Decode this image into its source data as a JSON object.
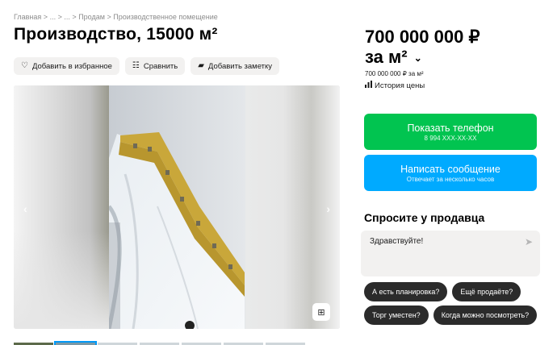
{
  "breadcrumb": {
    "items": [
      "Главная",
      "...",
      "...",
      "Продам",
      "Производственное помещение"
    ],
    "separator": ">"
  },
  "listing": {
    "title": "Производство, 15000 м²",
    "actions": [
      {
        "label": "Добавить в избранное",
        "icon": "heart-icon"
      },
      {
        "label": "Сравнить",
        "icon": "compare-icon"
      },
      {
        "label": "Добавить заметку",
        "icon": "note-icon"
      }
    ]
  },
  "gallery": {
    "prev_glyph": "‹",
    "next_glyph": "›",
    "expand_glyph": "⊞"
  },
  "price": {
    "main_line1": "700 000 000 ₽",
    "main_line2": "за м²",
    "chevron": "⌄",
    "sub": "700 000 000 ₽ за м²",
    "history_label": "История цены"
  },
  "contact": {
    "phone_button": {
      "label": "Показать телефон",
      "sub": "8 994 XXX-XX-XX"
    },
    "message_button": {
      "label": "Написать сообщение",
      "sub": "Отвечает за несколько часов"
    }
  },
  "ask_seller": {
    "heading": "Спросите у продавца",
    "message_value": "Здравствуйте!",
    "send_glyph": "➤",
    "suggestions": [
      "А есть планировка?",
      "Ещё продаёте?",
      "Торг уместен?",
      "Когда можно посмотреть?"
    ]
  },
  "colors": {
    "green": "#01c450",
    "blue": "#00aaff",
    "chip": "#2b2b2b",
    "button_bg": "#f2f1f0"
  }
}
